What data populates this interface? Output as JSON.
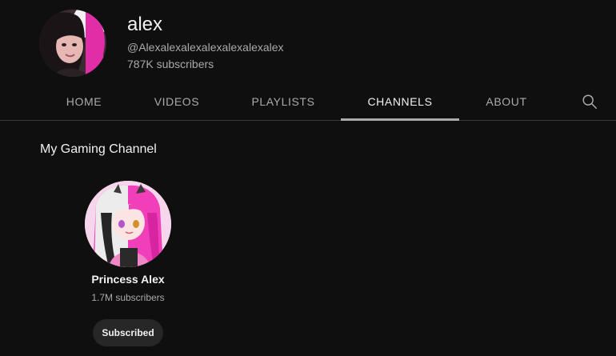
{
  "channel": {
    "name": "alex",
    "handle": "@Alexalexalexalexalexalexalex",
    "subscribers": "787K subscribers"
  },
  "tabs": [
    {
      "label": "HOME"
    },
    {
      "label": "VIDEOS"
    },
    {
      "label": "PLAYLISTS"
    },
    {
      "label": "CHANNELS",
      "active": true
    },
    {
      "label": "ABOUT"
    }
  ],
  "section": {
    "title": "My Gaming Channel",
    "channels": [
      {
        "name": "Princess Alex",
        "subscribers": "1.7M subscribers",
        "button_label": "Subscribed"
      }
    ]
  },
  "colors": {
    "background": "#0f0f0f",
    "text_primary": "#f1f1f1",
    "text_secondary": "#aaaaaa",
    "button_bg": "#272727",
    "accent_pink": "#e83fb8"
  },
  "icons": {
    "search": "search-icon"
  }
}
